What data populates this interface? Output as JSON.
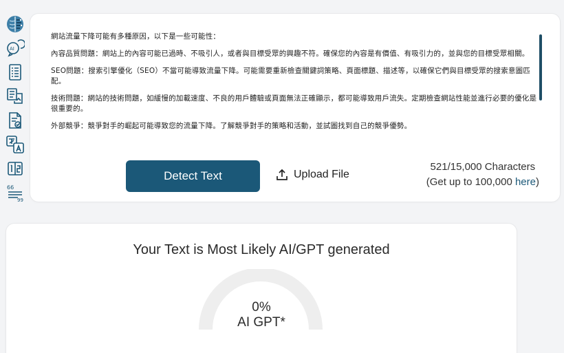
{
  "sidebar": {
    "icons": [
      "brain-icon",
      "ai-chat-icon",
      "document-list-icon",
      "paraphrase-icon",
      "document-check-icon",
      "translate-icon",
      "word-count-icon",
      "quote-icon"
    ]
  },
  "editor": {
    "paragraphs": [
      "網站流量下降可能有多種原因，以下是一些可能性：",
      "內容品質問題：網站上的內容可能已過時、不吸引人，或者與目標受眾的興趣不符。確保您的內容是有價值、有吸引力的，並與您的目標受眾相關。",
      "SEO問題：搜索引擎優化（SEO）不當可能導致流量下降。可能需要重新檢查關鍵詞策略、頁面標題、描述等，以確保它們與目標受眾的搜索意圖匹配。",
      "技術問題：網站的技術問題，如緩慢的加載速度、不良的用戶體驗或頁面無法正確顯示，都可能導致用戶流失。定期檢查網站性能並進行必要的優化是很重要的。",
      "外部競爭：競爭對手的崛起可能導致您的流量下降。了解競爭對手的策略和活動，並試圖找到自己的競爭優勢。"
    ]
  },
  "actions": {
    "detect_label": "Detect Text",
    "upload_label": "Upload File"
  },
  "char_info": {
    "count": "521/15,000 Characters",
    "upsell_prefix": "(Get up to 100,000 ",
    "upsell_link": "here",
    "upsell_suffix": ")"
  },
  "result": {
    "title": "Your Text is Most Likely AI/GPT generated",
    "percent": "0%",
    "label": "AI GPT*",
    "ai_fraction": 0
  },
  "colors": {
    "accent": "#1b5878",
    "gauge_track": "#eeeeee"
  }
}
